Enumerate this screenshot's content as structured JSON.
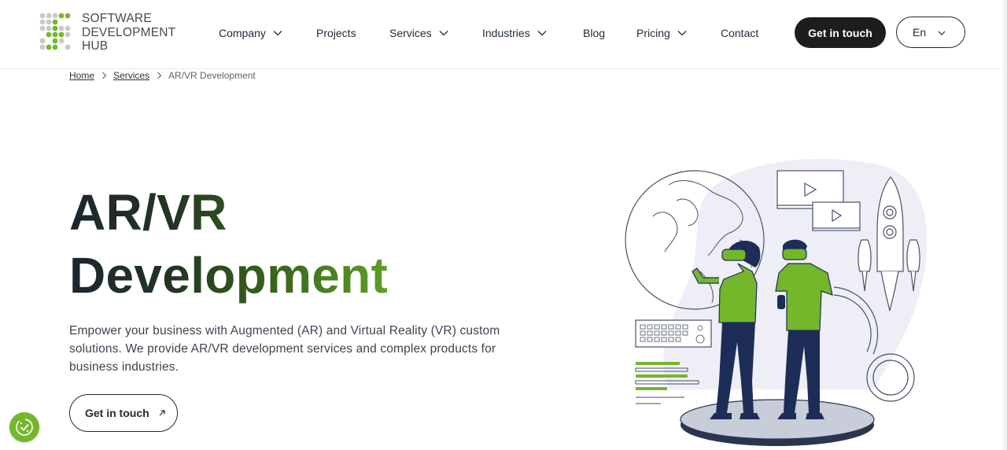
{
  "header": {
    "logo": {
      "line1": "SOFTWARE",
      "line2": "DEVELOPMENT",
      "line3": "HUB"
    },
    "nav": [
      {
        "label": "Company",
        "dropdown": true
      },
      {
        "label": "Projects",
        "dropdown": false
      },
      {
        "label": "Services",
        "dropdown": true
      },
      {
        "label": "Industries",
        "dropdown": true
      },
      {
        "label": "Blog",
        "dropdown": false
      },
      {
        "label": "Pricing",
        "dropdown": true
      },
      {
        "label": "Contact",
        "dropdown": false
      }
    ],
    "cta_label": "Get in touch",
    "language": "En"
  },
  "breadcrumb": {
    "home": "Home",
    "services": "Services",
    "current": "AR/VR Development"
  },
  "hero": {
    "title_line1": "AR/VR",
    "title_line2": "Development",
    "description": "Empower your business with Augmented (AR) and Virtual Reality (VR) custom solutions. We provide AR/VR development services and complex products for business industries.",
    "button_label": "Get in touch"
  },
  "icons": {
    "chevron": "chevron-down-icon",
    "breadcrumb_separator": "chevron-right-icon",
    "button_arrow": "arrow-up-right-icon",
    "cookie": "cookie-settings-icon"
  },
  "colors": {
    "accent_green": "#74b72b",
    "dark": "#1d1d1f",
    "navy": "#1e2d57",
    "illustration_bg": "#eeeef6"
  }
}
